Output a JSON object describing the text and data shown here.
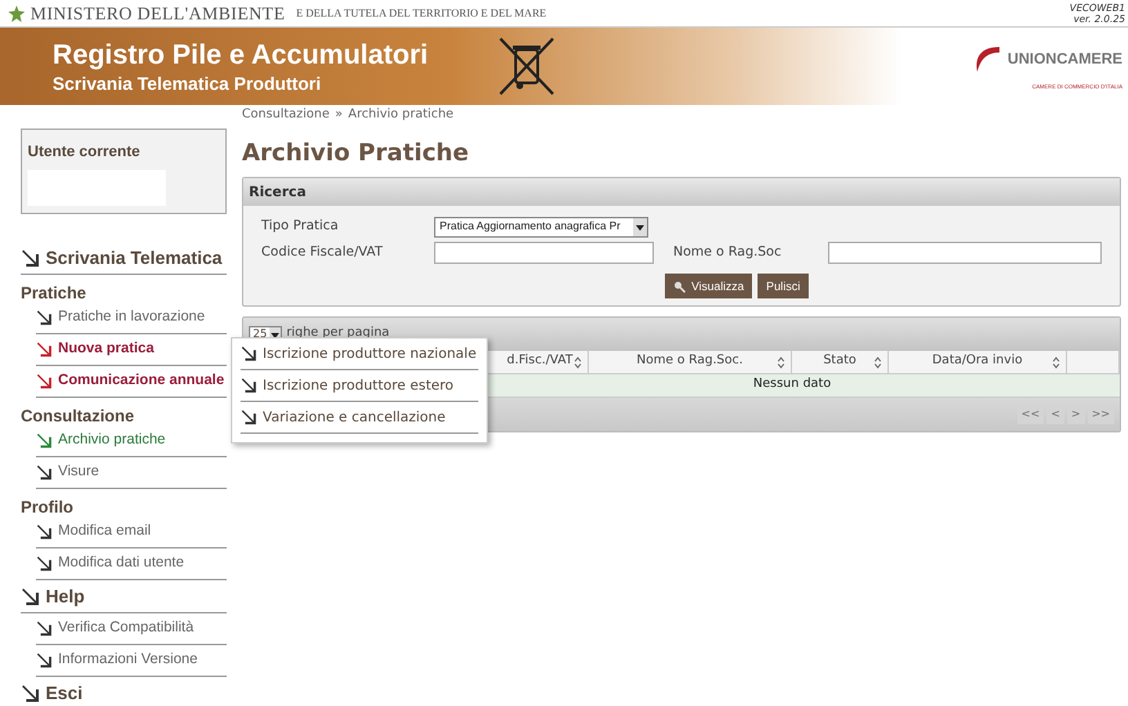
{
  "header": {
    "ministry": "MINISTERO DELL'AMBIENTE",
    "ministry_sub": "E DELLA TUTELA DEL TERRITORIO E DEL MARE",
    "version_lines": [
      "VECOWEB1",
      "ver. 2.0.25"
    ],
    "title": "Registro Pile e Accumulatori",
    "subtitle": "Scrivania Telematica Produttori",
    "partner": "UNIONCAMERE",
    "partner_sub": "CAMERE DI COMMERCIO D'ITALIA"
  },
  "breadcrumb": [
    "Consultazione",
    "»",
    "Archivio pratiche"
  ],
  "user_box": {
    "label": "Utente corrente"
  },
  "sidebar": [
    {
      "kind": "link",
      "label": "Scrivania Telematica"
    },
    {
      "kind": "group",
      "label": "Pratiche",
      "items": [
        {
          "label": "Pratiche in lavorazione",
          "selected": false,
          "highlighted": false
        },
        {
          "label": "Nuova pratica",
          "selected": false,
          "highlighted": true
        },
        {
          "label": "Comunicazione annuale",
          "selected": false,
          "highlighted": true
        }
      ]
    },
    {
      "kind": "group",
      "label": "Consultazione",
      "items": [
        {
          "label": "Archivio pratiche",
          "selected": true,
          "highlighted": false
        },
        {
          "label": "Visure",
          "selected": false,
          "highlighted": false
        }
      ]
    },
    {
      "kind": "group",
      "label": "Profilo",
      "items": [
        {
          "label": "Modifica email",
          "selected": false,
          "highlighted": false
        },
        {
          "label": "Modifica dati utente",
          "selected": false,
          "highlighted": false
        }
      ]
    },
    {
      "kind": "link",
      "label": "Help"
    },
    {
      "kind": "group",
      "items": [
        {
          "label": "Verifica Compatibilità",
          "selected": false,
          "highlighted": false
        },
        {
          "label": "Informazioni Versione",
          "selected": false,
          "highlighted": false
        }
      ]
    },
    {
      "kind": "link",
      "label": "Esci"
    }
  ],
  "page_title": "Archivio Pratiche",
  "search": {
    "title": "Ricerca",
    "tipo_label": "Tipo Pratica",
    "tipo_value": "Pratica Aggiornamento anagrafica Pr",
    "cf_label": "Codice Fiscale/VAT",
    "nome_label": "Nome o Rag.Soc",
    "buttons": [
      {
        "label": "Visualizza",
        "kind": "search"
      },
      {
        "label": "Pulisci",
        "kind": "plain"
      }
    ]
  },
  "results": {
    "page_size": "25",
    "page_size_label": "righe per pagina",
    "columns": [
      "d.Fisc./VAT",
      "Nome o Rag.Soc.",
      "Stato",
      "Data/Ora invio",
      ""
    ],
    "empty": "Nessun dato",
    "pager": [
      "<<",
      "<",
      ">",
      ">>"
    ]
  },
  "popup_menu": [
    "Iscrizione produttore nazionale",
    "Iscrizione produttore estero",
    "Variazione e cancellazione"
  ]
}
